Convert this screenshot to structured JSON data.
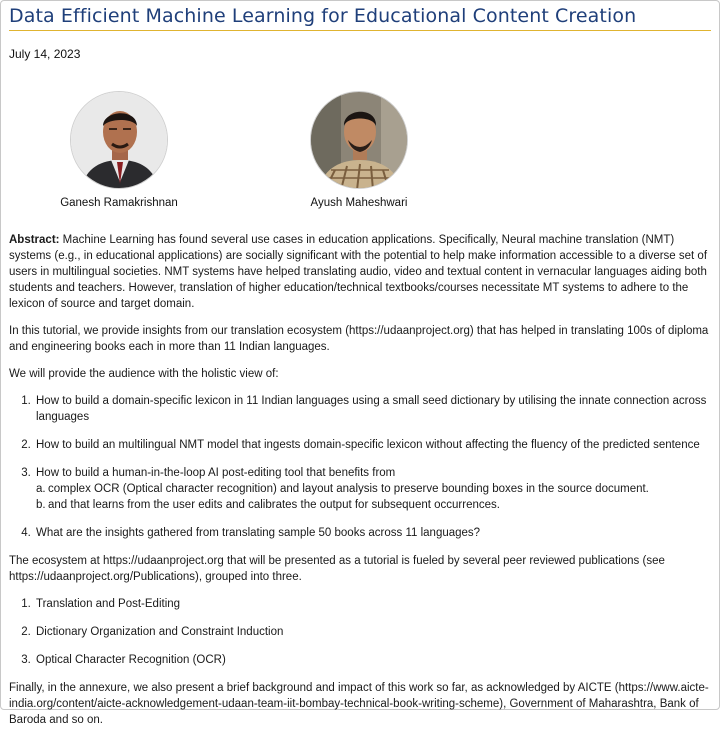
{
  "title": "Data Efficient Machine Learning for Educational Content Creation",
  "date": "July 14, 2023",
  "authors": [
    {
      "name": "Ganesh Ramakrishnan"
    },
    {
      "name": "Ayush Maheshwari"
    }
  ],
  "abstract": {
    "label": "Abstract:",
    "text": " Machine Learning has found several use cases in education applications. Specifically, Neural machine translation (NMT) systems (e.g., in educational applications) are socially significant with the potential to help make information accessible to a diverse set of users in multilingual societies. NMT systems have helped translating audio, video and textual content in vernacular languages aiding both students and teachers. However, translation of higher education/technical textbooks/courses necessitate MT systems to adhere to the lexicon of source and target domain."
  },
  "para_tutorial": "In this tutorial, we provide insights from our translation ecosystem (https://udaanproject.org) that has helped in translating 100s of diploma and engineering books each in more than 11 Indian languages.",
  "para_view": "We will provide the audience with the holistic view of:",
  "view_items": [
    {
      "text": "How to build a domain-specific lexicon in 11 Indian languages using a small seed dictionary by utilising the innate connection across languages"
    },
    {
      "text": "How to build an multilingual NMT model that ingests domain-specific lexicon without affecting the fluency of the predicted sentence"
    },
    {
      "text": "How to build a human-in-the-loop AI post-editing tool that benefits from",
      "sub": [
        {
          "marker": "a.",
          "text": "complex OCR (Optical character recognition) and layout analysis to preserve bounding boxes in the source document."
        },
        {
          "marker": "b.",
          "text": "and that learns from the user edits and calibrates the output for subsequent occurrences."
        }
      ]
    },
    {
      "text": "What are the insights gathered from translating sample 50 books across 11 languages?"
    }
  ],
  "para_ecosystem": "The ecosystem at https://udaanproject.org that will be presented as a tutorial is fueled by several peer reviewed publications (see https://udaanproject.org/Publications), grouped into three.",
  "groups": [
    "Translation and Post-Editing",
    "Dictionary Organization and Constraint Induction",
    "Optical Character Recognition (OCR)"
  ],
  "para_final": "Finally, in the annexure, we also present a brief background and impact of this work so far, as acknowledged by AICTE (https://www.aicte-india.org/content/aicte-acknowledgement-udaan-team-iit-bombay-technical-book-writing-scheme), Government of Maharashtra, Bank of Baroda and so on."
}
